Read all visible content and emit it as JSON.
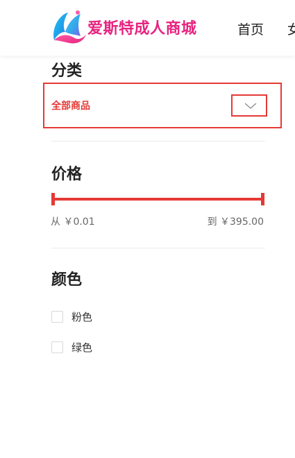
{
  "header": {
    "brand_name": "爱斯特成人商城",
    "nav": {
      "home": "首页",
      "women": "女"
    }
  },
  "filters": {
    "category": {
      "title": "分类",
      "selected": "全部商品"
    },
    "price": {
      "title": "价格",
      "min_label": "从 ￥0.01",
      "max_label": "到 ￥395.00",
      "min_value": 0.01,
      "max_value": 395.0
    },
    "color": {
      "title": "颜色",
      "options": [
        {
          "label": "粉色",
          "checked": false
        },
        {
          "label": "绿色",
          "checked": false
        }
      ]
    }
  },
  "colors": {
    "accent_red": "#e53935",
    "brand_pink": "#e7237f",
    "brand_blue": "#1e9be9"
  }
}
